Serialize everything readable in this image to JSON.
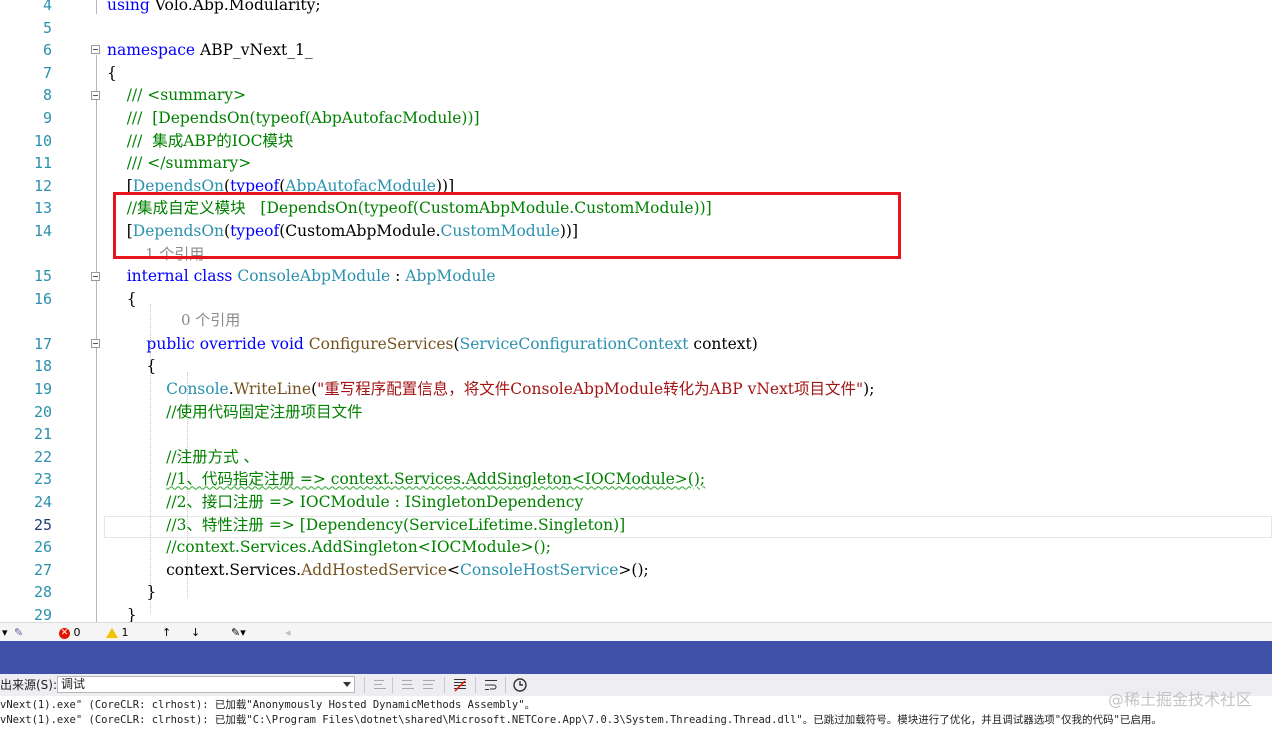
{
  "colors": {
    "keyword": "#0000ff",
    "type": "#2b91af",
    "comment": "#008000",
    "string": "#a31515",
    "method": "#74531f",
    "plain": "#000000",
    "lens": "#8a8a8a",
    "line_number": "#2b91af",
    "highlight_box": "#e8141c",
    "panel_band": "#3f51a8"
  },
  "editor": {
    "current_line": "25",
    "lines": [
      {
        "n": "4",
        "spans": [
          {
            "t": "using",
            "c": "keyword"
          },
          {
            "t": " Volo.Abp.Modularity;",
            "c": "plain"
          }
        ]
      },
      {
        "n": "5",
        "spans": []
      },
      {
        "n": "6",
        "spans": [
          {
            "t": "namespace",
            "c": "keyword"
          },
          {
            "t": " ABP_vNext_1_",
            "c": "plain"
          }
        ]
      },
      {
        "n": "7",
        "spans": [
          {
            "t": "{",
            "c": "plain"
          }
        ]
      },
      {
        "n": "8",
        "spans": [
          {
            "t": "    /// <summary>",
            "c": "comment"
          }
        ]
      },
      {
        "n": "9",
        "spans": [
          {
            "t": "    ///  [DependsOn(typeof(AbpAutofacModule))]",
            "c": "comment"
          }
        ]
      },
      {
        "n": "10",
        "spans": [
          {
            "t": "    ///  集成ABP的IOC模块",
            "c": "comment"
          }
        ]
      },
      {
        "n": "11",
        "spans": [
          {
            "t": "    /// </summary>",
            "c": "comment"
          }
        ]
      },
      {
        "n": "12",
        "spans": [
          {
            "t": "    [",
            "c": "plain"
          },
          {
            "t": "DependsOn",
            "c": "type"
          },
          {
            "t": "(",
            "c": "plain"
          },
          {
            "t": "typeof",
            "c": "keyword"
          },
          {
            "t": "(",
            "c": "plain"
          },
          {
            "t": "AbpAutofacModule",
            "c": "type"
          },
          {
            "t": "))]",
            "c": "plain"
          }
        ]
      },
      {
        "n": "13",
        "spans": [
          {
            "t": "    //集成自定义模块   [DependsOn(typeof(CustomAbpModule.CustomModule))]",
            "c": "comment"
          }
        ]
      },
      {
        "n": "14",
        "spans": [
          {
            "t": "    [",
            "c": "plain"
          },
          {
            "t": "DependsOn",
            "c": "type"
          },
          {
            "t": "(",
            "c": "plain"
          },
          {
            "t": "typeof",
            "c": "keyword"
          },
          {
            "t": "(CustomAbpModule.",
            "c": "plain"
          },
          {
            "t": "CustomModule",
            "c": "type"
          },
          {
            "t": "))]",
            "c": "plain"
          }
        ]
      },
      {
        "n": "15",
        "spans": [
          {
            "t": "    ",
            "c": "plain"
          },
          {
            "t": "internal",
            "c": "keyword"
          },
          {
            "t": " ",
            "c": "plain"
          },
          {
            "t": "class",
            "c": "keyword"
          },
          {
            "t": " ",
            "c": "plain"
          },
          {
            "t": "ConsoleAbpModule",
            "c": "type"
          },
          {
            "t": " : ",
            "c": "plain"
          },
          {
            "t": "AbpModule",
            "c": "type"
          }
        ]
      },
      {
        "n": "16",
        "spans": [
          {
            "t": "    {",
            "c": "plain"
          }
        ]
      },
      {
        "n": "17",
        "spans": [
          {
            "t": "        ",
            "c": "plain"
          },
          {
            "t": "public",
            "c": "keyword"
          },
          {
            "t": " ",
            "c": "plain"
          },
          {
            "t": "override",
            "c": "keyword"
          },
          {
            "t": " ",
            "c": "plain"
          },
          {
            "t": "void",
            "c": "keyword"
          },
          {
            "t": " ",
            "c": "plain"
          },
          {
            "t": "ConfigureServices",
            "c": "method"
          },
          {
            "t": "(",
            "c": "plain"
          },
          {
            "t": "ServiceConfigurationContext",
            "c": "type"
          },
          {
            "t": " context)",
            "c": "plain"
          }
        ]
      },
      {
        "n": "18",
        "spans": [
          {
            "t": "        {",
            "c": "plain"
          }
        ]
      },
      {
        "n": "19",
        "spans": [
          {
            "t": "            ",
            "c": "plain"
          },
          {
            "t": "Console",
            "c": "type"
          },
          {
            "t": ".",
            "c": "plain"
          },
          {
            "t": "WriteLine",
            "c": "method"
          },
          {
            "t": "(",
            "c": "plain"
          },
          {
            "t": "\"重写程序配置信息，将文件ConsoleAbpModule转化为ABP vNext项目文件\"",
            "c": "string"
          },
          {
            "t": ");",
            "c": "plain"
          }
        ]
      },
      {
        "n": "20",
        "spans": [
          {
            "t": "            //使用代码固定注册项目文件",
            "c": "comment"
          }
        ]
      },
      {
        "n": "21",
        "spans": []
      },
      {
        "n": "22",
        "spans": [
          {
            "t": "            //注册方式 、",
            "c": "comment"
          }
        ]
      },
      {
        "n": "23",
        "spans": [
          {
            "t": "            ",
            "c": "plain"
          },
          {
            "t": "//1、代码指定注册 => context.Services.AddSingleton<IOCModule>();",
            "c": "comment",
            "squiggle": true
          }
        ]
      },
      {
        "n": "24",
        "spans": [
          {
            "t": "            //2、接口注册 => IOCModule : ISingletonDependency",
            "c": "comment"
          }
        ]
      },
      {
        "n": "25",
        "spans": [
          {
            "t": "            //3、特性注册 => [Dependency(ServiceLifetime.Singleton)]",
            "c": "comment"
          }
        ]
      },
      {
        "n": "26",
        "spans": [
          {
            "t": "            //context.Services.AddSingleton<IOCModule>();",
            "c": "comment"
          }
        ]
      },
      {
        "n": "27",
        "spans": [
          {
            "t": "            context.",
            "c": "plain"
          },
          {
            "t": "Services",
            "c": "plain"
          },
          {
            "t": ".",
            "c": "plain"
          },
          {
            "t": "AddHostedService",
            "c": "method"
          },
          {
            "t": "<",
            "c": "plain"
          },
          {
            "t": "ConsoleHostService",
            "c": "type"
          },
          {
            "t": ">();",
            "c": "plain"
          }
        ]
      },
      {
        "n": "28",
        "spans": [
          {
            "t": "        }",
            "c": "plain"
          }
        ]
      },
      {
        "n": "29",
        "spans": [
          {
            "t": "    }",
            "c": "plain"
          }
        ]
      }
    ],
    "lens_refs": {
      "class_refs": "1 个引用",
      "method_refs": "0 个引用"
    }
  },
  "status": {
    "errors": "0",
    "warnings": "1",
    "error_glyph": "✕"
  },
  "output_panel": {
    "source_label": "出来源(S):",
    "source_value": "调试",
    "lines": [
      "vNext(1).exe\" (CoreCLR: clrhost): 已加载\"Anonymously Hosted DynamicMethods Assembly\"。",
      "vNext(1).exe\" (CoreCLR: clrhost): 已加载\"C:\\Program Files\\dotnet\\shared\\Microsoft.NETCore.App\\7.0.3\\System.Threading.Thread.dll\"。已跳过加载符号。模块进行了优化，并且调试器选项\"仅我的代码\"已启用。"
    ]
  },
  "watermark": "@稀土掘金技术社区"
}
